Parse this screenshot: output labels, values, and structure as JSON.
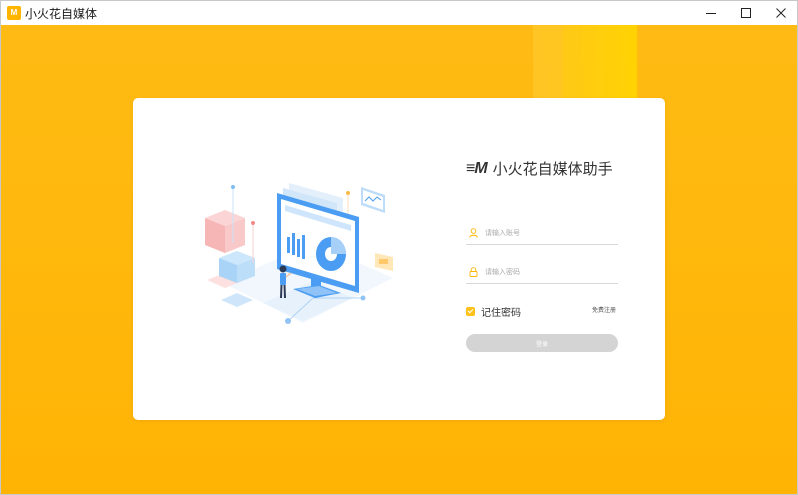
{
  "window": {
    "title": "小火花自媒体",
    "icon": "app-logo-icon",
    "controls": [
      "minimize-icon",
      "maximize-icon",
      "close-icon"
    ]
  },
  "colors": {
    "background": "#ffb404",
    "accent": "#ffc21a",
    "card": "#ffffff",
    "button_disabled": "#d4d4d4",
    "illustration_blue": "#4a9df2"
  },
  "login": {
    "brand_logo": "≡M",
    "brand_name": "小火花自媒体助手",
    "username_placeholder": "请输入账号",
    "password_placeholder": "请输入密码",
    "remember_label": "记住密码",
    "remember_checked": true,
    "register_link": "免费注册",
    "login_button": "登录"
  }
}
